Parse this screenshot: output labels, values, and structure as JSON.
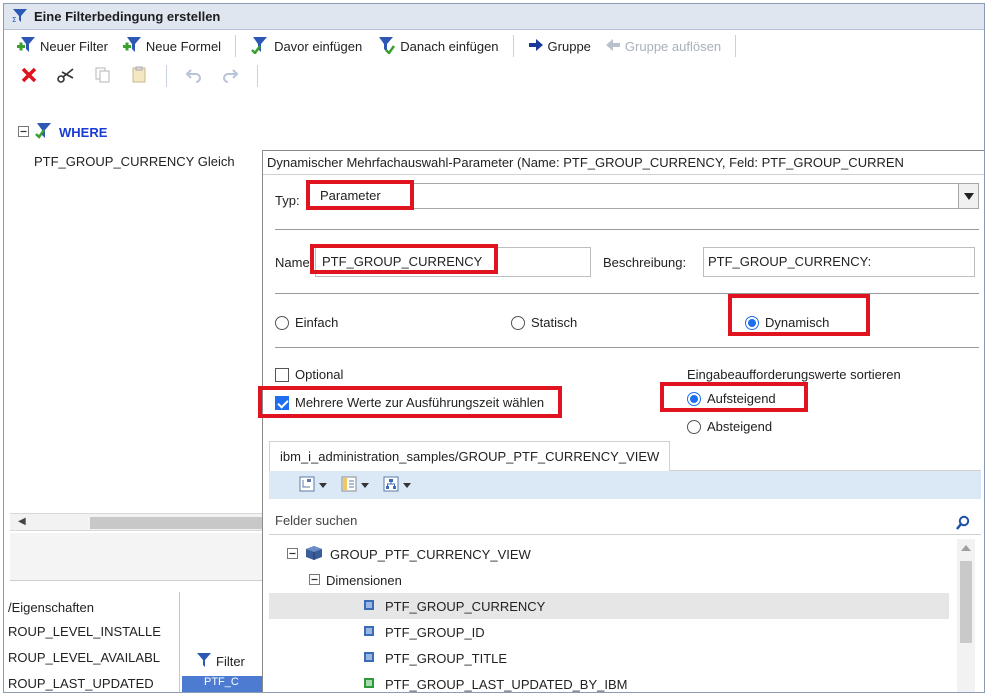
{
  "window": {
    "title": "Eine Filterbedingung erstellen"
  },
  "toolbar": {
    "new_filter": "Neuer Filter",
    "new_formula": "Neue Formel",
    "insert_before": "Davor einfügen",
    "insert_after": "Danach einfügen",
    "group": "Gruppe",
    "ungroup": "Gruppe auflösen"
  },
  "tree": {
    "where": "WHERE",
    "condition": "PTF_GROUP_CURRENCY  Gleich"
  },
  "popup": {
    "title": "Dynamischer Mehrfachauswahl-Parameter (Name: PTF_GROUP_CURRENCY, Feld: PTF_GROUP_CURREN",
    "type_label": "Typ:",
    "type_value": "Parameter",
    "name_label": "Name",
    "name_value": "PTF_GROUP_CURRENCY",
    "desc_label": "Beschreibung:",
    "desc_value": "PTF_GROUP_CURRENCY:",
    "radio_simple": "Einfach",
    "radio_static": "Statisch",
    "radio_dynamic": "Dynamisch",
    "optional": "Optional",
    "multi_values": "Mehrere Werte zur Ausführungszeit wählen",
    "sort_label": "Eingabeaufforderungswerte sortieren",
    "ascending": "Aufsteigend",
    "descending": "Absteigend",
    "source_tab": "ibm_i_administration_samples/GROUP_PTF_CURRENCY_VIEW",
    "search_placeholder": "Felder suchen",
    "view_node": "GROUP_PTF_CURRENCY_VIEW",
    "dimensions": "Dimensionen",
    "fields": [
      "PTF_GROUP_CURRENCY",
      "PTF_GROUP_ID",
      "PTF_GROUP_TITLE",
      "PTF_GROUP_LAST_UPDATED_BY_IBM"
    ]
  },
  "bottom": {
    "properties": "/Eigenschaften",
    "rows": [
      "ROUP_LEVEL_INSTALLE",
      "ROUP_LEVEL_AVAILABL",
      "ROUP_LAST_UPDATED"
    ],
    "filter_tab": "Filter",
    "ptf_tab": "PTF_C"
  },
  "colors": {
    "highlight": "#e0141e",
    "accent": "#1e6ff0",
    "where": "#1a3bd4"
  }
}
